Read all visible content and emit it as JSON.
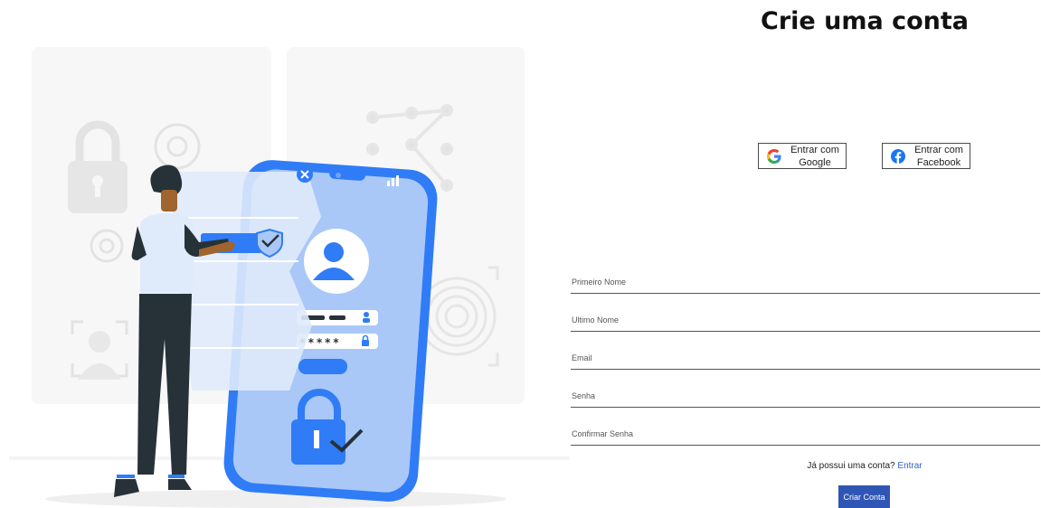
{
  "page": {
    "title": "Crie uma conta"
  },
  "social": {
    "google_label": "Entrar com Google",
    "facebook_label": "Entrar com Facebook",
    "google_icon": "google-icon",
    "facebook_icon": "facebook-icon",
    "google_colors": [
      "#4285F4",
      "#EA4335",
      "#FBBC05",
      "#34A853"
    ],
    "facebook_color": "#1877F2"
  },
  "form": {
    "first_name": {
      "placeholder": "Primeiro Nome",
      "value": ""
    },
    "last_name": {
      "placeholder": "Ultimo Nome",
      "value": ""
    },
    "email": {
      "placeholder": "Email",
      "value": ""
    },
    "password": {
      "placeholder": "Senha",
      "value": ""
    },
    "confirm_password": {
      "placeholder": "Confirmar Senha",
      "value": ""
    }
  },
  "login_prompt": {
    "text": "Já possui uma conta?",
    "link": "Entrar"
  },
  "submit_label": "Criar Conta",
  "illustration": {
    "password_mask": "*****",
    "accent_color": "#2f7cf6",
    "light_accent_color": "#a9c8f8"
  }
}
